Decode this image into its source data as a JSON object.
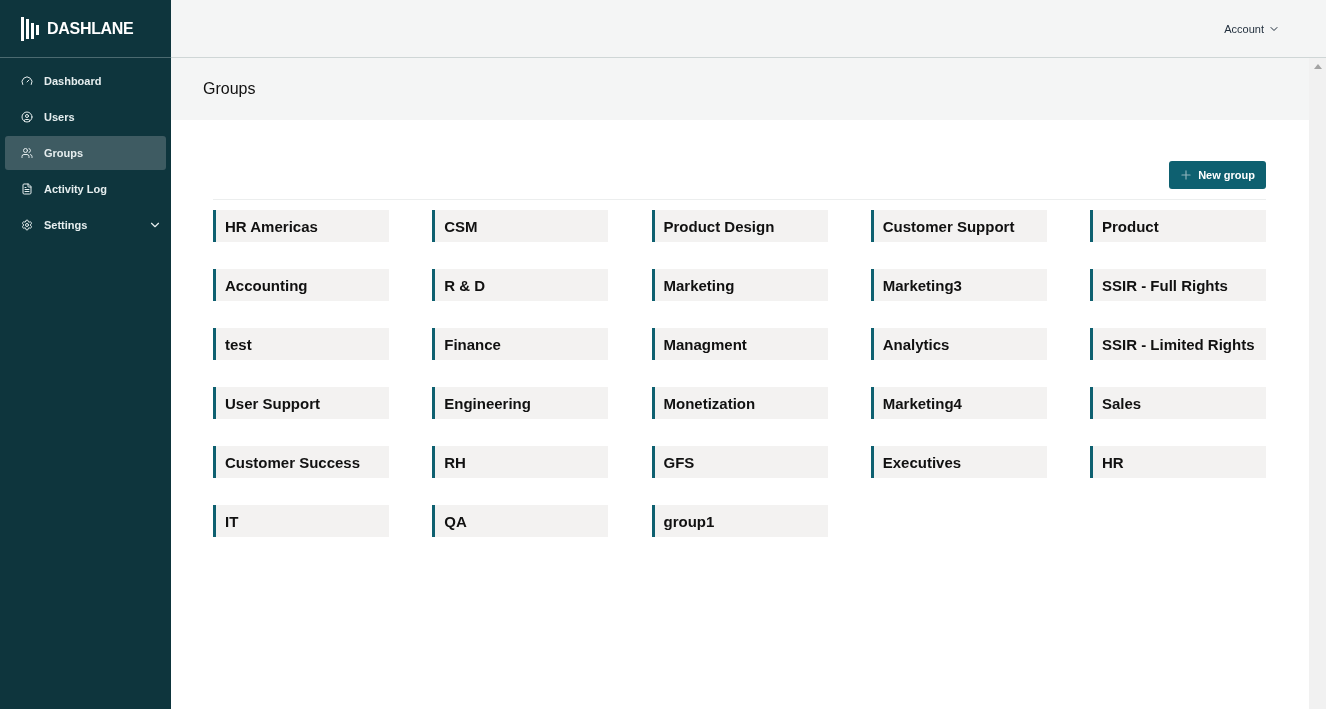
{
  "brand": "DASHLANE",
  "sidebar": {
    "items": [
      {
        "label": "Dashboard",
        "kind": "gauge",
        "selected": false,
        "expandable": false
      },
      {
        "label": "Users",
        "kind": "user",
        "selected": false,
        "expandable": false
      },
      {
        "label": "Groups",
        "kind": "users",
        "selected": true,
        "expandable": false
      },
      {
        "label": "Activity Log",
        "kind": "log",
        "selected": false,
        "expandable": false
      },
      {
        "label": "Settings",
        "kind": "gear",
        "selected": false,
        "expandable": true
      }
    ]
  },
  "header": {
    "account": "Account"
  },
  "page": {
    "title": "Groups",
    "new_button": "New group"
  },
  "groups": [
    "HR Americas",
    "CSM",
    "Product Design",
    "Customer Support",
    "Product",
    "Accounting",
    "R & D",
    "Marketing",
    "Marketing3",
    "SSIR - Full Rights",
    "test",
    "Finance",
    "Managment",
    "Analytics",
    "SSIR - Limited Rights",
    "User Support",
    "Engineering",
    "Monetization",
    "Marketing4",
    "Sales",
    "Customer Success",
    "RH",
    "GFS",
    "Executives",
    "HR",
    "IT",
    "QA",
    "group1"
  ]
}
